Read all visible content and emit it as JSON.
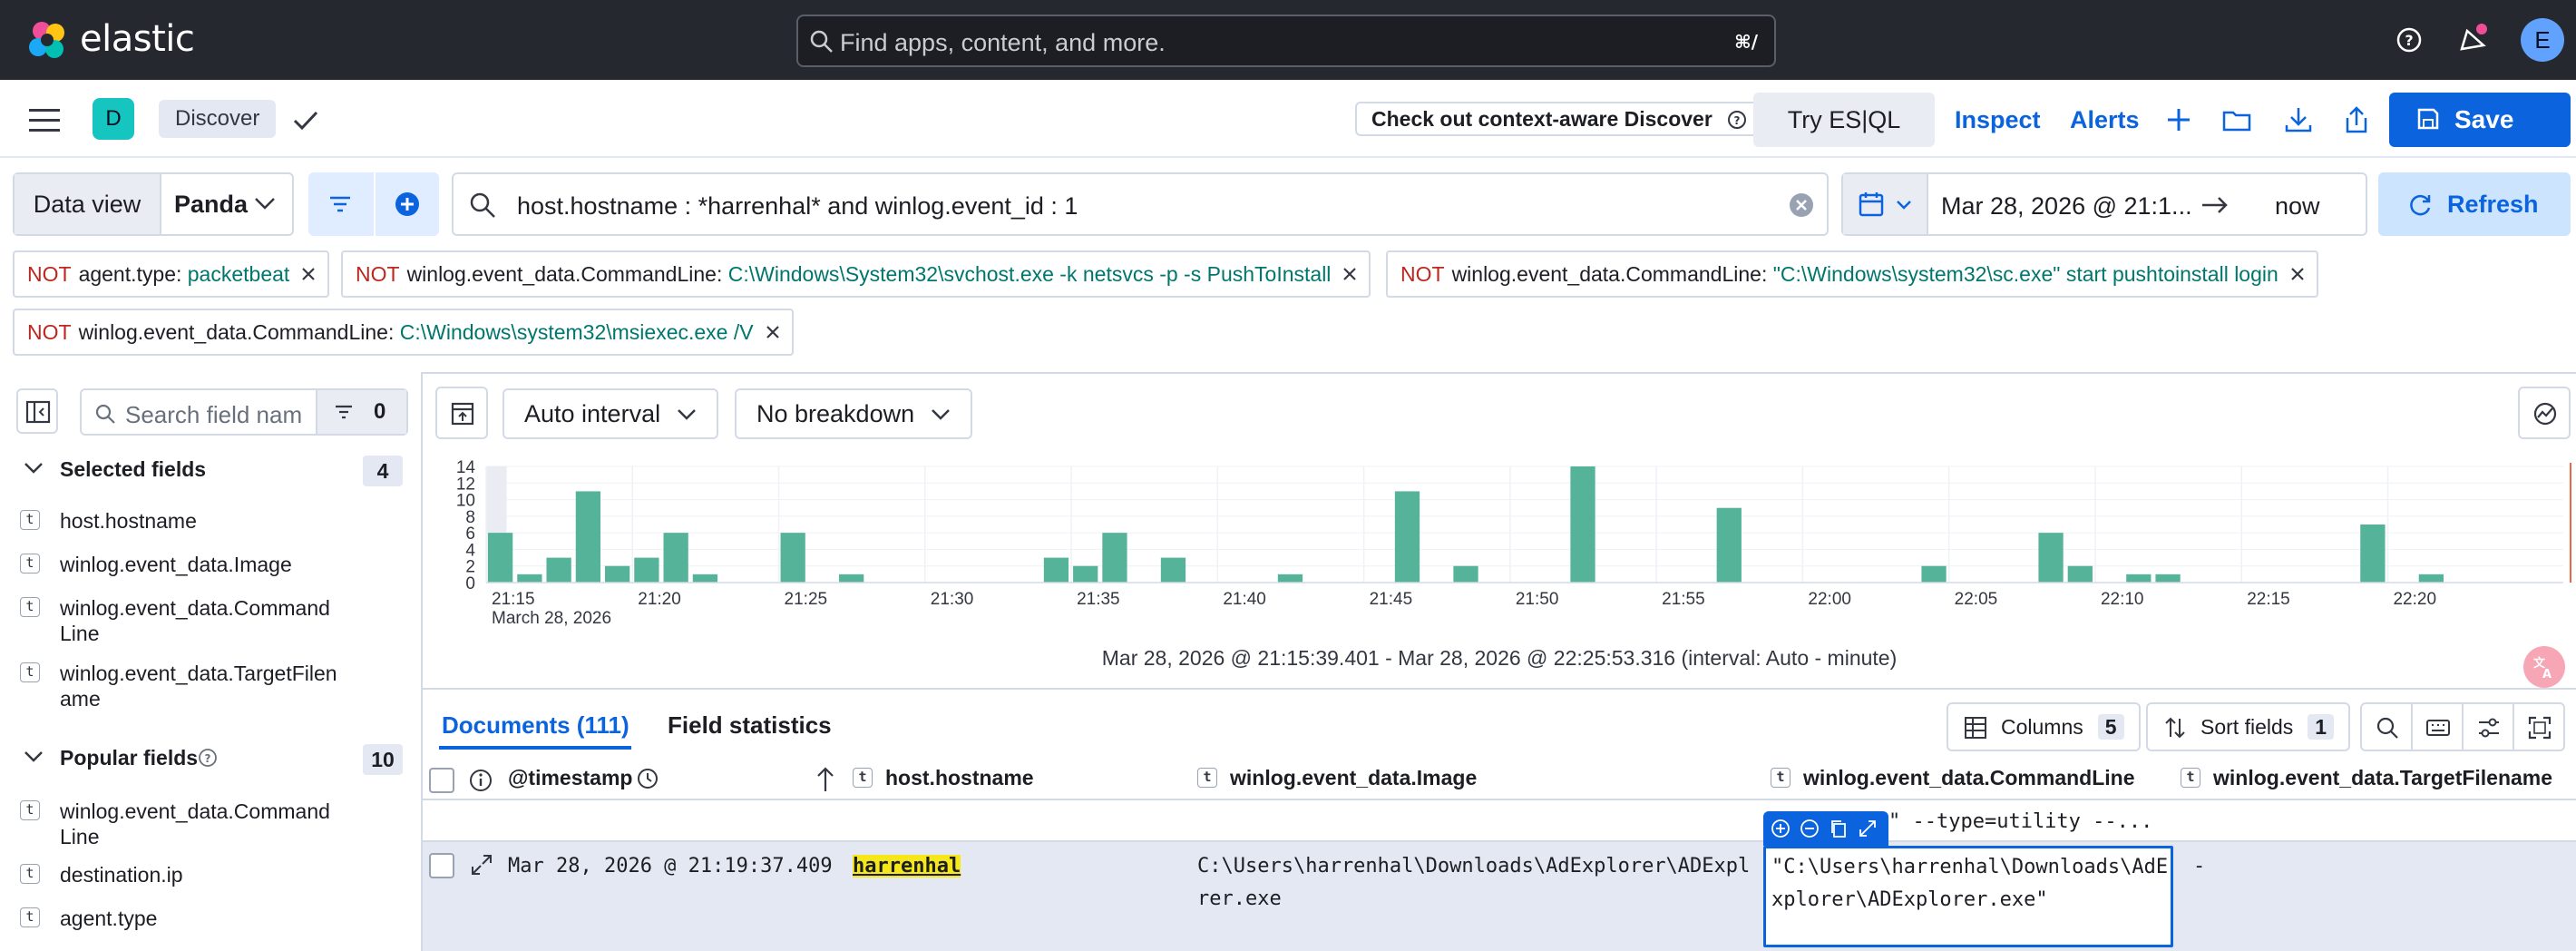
{
  "header": {
    "brand": "elastic",
    "search_placeholder": "Find apps, content, and more.",
    "search_shortcut": "⌘/",
    "avatar_initial": "E"
  },
  "app_bar": {
    "space_initial": "D",
    "breadcrumb": "Discover",
    "context_aware_label": "Check out context-aware Discover",
    "try_esql_label": "Try ES|QL",
    "inspect_label": "Inspect",
    "alerts_label": "Alerts",
    "save_label": "Save"
  },
  "query_bar": {
    "data_view_label": "Data view",
    "data_view_value": "Panda",
    "query": "host.hostname : *harrenhal* and winlog.event_id : 1",
    "start_date": "Mar 28, 2026 @ 21:1...",
    "end_date": "now",
    "refresh_label": "Refresh"
  },
  "filters": [
    {
      "not": "NOT",
      "field": "agent.type:",
      "value": "packetbeat"
    },
    {
      "not": "NOT",
      "field": "winlog.event_data.CommandLine:",
      "value": "C:\\Windows\\System32\\svchost.exe -k netsvcs -p -s PushToInstall"
    },
    {
      "not": "NOT",
      "field": "winlog.event_data.CommandLine:",
      "value": "\"C:\\Windows\\system32\\sc.exe\" start pushtoinstall login"
    },
    {
      "not": "NOT",
      "field": "winlog.event_data.CommandLine:",
      "value": "C:\\Windows\\system32\\msiexec.exe /V"
    }
  ],
  "sidebar": {
    "search_placeholder": "Search field names",
    "filter_count": "0",
    "selected_title": "Selected fields",
    "selected_count": "4",
    "selected_fields": [
      "host.hostname",
      "winlog.event_data.Image",
      "winlog.event_data.CommandLine",
      "winlog.event_data.TargetFilename"
    ],
    "popular_title": "Popular fields",
    "popular_count": "10",
    "popular_fields": [
      "winlog.event_data.CommandLine",
      "destination.ip",
      "agent.type"
    ],
    "field_type_glyph": "t"
  },
  "chart": {
    "interval_label": "Auto interval",
    "breakdown_label": "No breakdown",
    "caption": "Mar 28, 2026 @ 21:15:39.401 - Mar 28, 2026 @ 22:25:53.316 (interval: Auto - minute)",
    "color": "#54b399"
  },
  "chart_data": {
    "type": "bar",
    "x_unit": "minute",
    "x_start": "21:15",
    "x_date_label": "March 28, 2026",
    "x_tick_labels": [
      "21:15",
      "21:20",
      "21:25",
      "21:30",
      "21:35",
      "21:40",
      "21:45",
      "21:50",
      "21:55",
      "22:00",
      "22:05",
      "22:10",
      "22:15",
      "22:20"
    ],
    "y_tick_labels": [
      "14",
      "12",
      "10",
      "8",
      "6",
      "4",
      "2",
      "0"
    ],
    "ylim": [
      0,
      14
    ],
    "values": [
      6,
      1,
      3,
      11,
      2,
      3,
      6,
      1,
      0,
      0,
      0,
      0,
      6,
      0,
      0,
      1,
      0,
      0,
      0,
      0,
      0,
      0,
      0,
      0,
      0,
      0,
      0,
      0,
      0,
      0,
      3,
      2,
      6,
      0,
      3,
      0,
      0,
      0,
      0,
      0,
      0,
      0,
      0,
      0,
      0,
      0,
      0,
      0,
      0,
      0,
      0,
      0,
      1,
      0,
      0,
      0,
      0,
      0,
      0,
      0,
      0,
      0,
      0,
      0,
      0,
      0,
      0,
      0,
      0,
      0,
      0,
      0,
      0,
      0,
      0,
      0,
      0,
      0,
      0,
      0,
      0,
      0,
      0,
      0,
      0,
      0,
      0,
      0,
      0,
      0,
      0,
      0,
      0,
      0,
      0,
      0,
      0,
      0,
      0,
      0,
      0,
      0,
      0,
      0,
      0,
      0,
      0,
      0,
      0,
      0,
      0,
      0,
      0,
      0,
      0,
      0,
      0,
      0,
      0,
      0,
      0,
      0,
      0,
      0,
      0,
      0,
      0,
      0,
      0,
      0,
      0,
      0,
      0,
      0,
      0
    ],
    "bars": [
      {
        "x": 0,
        "v": 6
      },
      {
        "x": 1,
        "v": 1
      },
      {
        "x": 2,
        "v": 3
      },
      {
        "x": 3,
        "v": 11
      },
      {
        "x": 4,
        "v": 2
      },
      {
        "x": 5,
        "v": 3
      },
      {
        "x": 6,
        "v": 6
      },
      {
        "x": 7,
        "v": 1
      },
      {
        "x": 10,
        "v": 6
      },
      {
        "x": 12,
        "v": 1
      },
      {
        "x": 19,
        "v": 3
      },
      {
        "x": 20,
        "v": 2
      },
      {
        "x": 21,
        "v": 6
      },
      {
        "x": 23,
        "v": 3
      },
      {
        "x": 27,
        "v": 1
      },
      {
        "x": 31,
        "v": 11
      },
      {
        "x": 33,
        "v": 2
      },
      {
        "x": 37,
        "v": 14
      },
      {
        "x": 42,
        "v": 9
      },
      {
        "x": 49,
        "v": 2
      },
      {
        "x": 53,
        "v": 6
      },
      {
        "x": 54,
        "v": 2
      },
      {
        "x": 56,
        "v": 1
      },
      {
        "x": 57,
        "v": 1
      },
      {
        "x": 64,
        "v": 7
      },
      {
        "x": 66,
        "v": 1
      }
    ]
  },
  "documents": {
    "tab_documents": "Documents (111)",
    "tab_field_stats": "Field statistics",
    "columns_label": "Columns",
    "columns_count": "5",
    "sort_label": "Sort fields",
    "sort_count": "1",
    "headers": {
      "timestamp": "@timestamp",
      "hostname": "host.hostname",
      "image": "winlog.event_data.Image",
      "commandline": "winlog.event_data.CommandLine",
      "targetfilename": "winlog.event_data.TargetFilename"
    },
    "prev_row_cmd_tail": "\" --type=utility --...",
    "row": {
      "timestamp": "Mar 28, 2026 @ 21:19:37.409",
      "hostname": "harrenhal",
      "image_line1": "C:\\Users\\harrenhal\\Downloads\\AdExplorer\\ADExplo",
      "image_line2": "rer.exe",
      "cmd_line1": "\"C:\\Users\\harrenhal\\Downloads\\AdE",
      "cmd_line2": "xplorer\\ADExplorer.exe\"",
      "target": "-"
    }
  }
}
